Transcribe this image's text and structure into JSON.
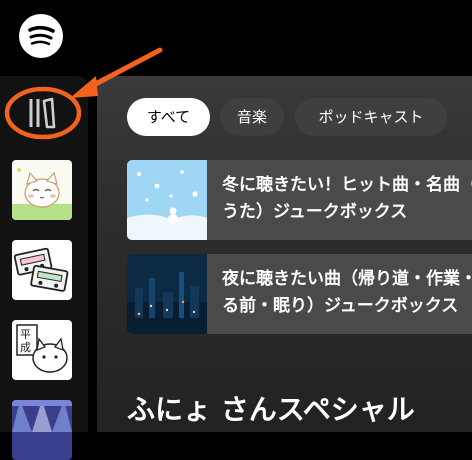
{
  "filters": [
    {
      "label": "すべて",
      "active": true
    },
    {
      "label": "音楽",
      "active": false
    },
    {
      "label": "ポッドキャスト",
      "active": false
    }
  ],
  "cards": [
    {
      "title": "冬に聴きたい！ヒット曲・名曲（冬うた）ジュークボックス"
    },
    {
      "title": "夜に聴きたい曲（帰り道・作業・寝る前・眠り）ジュークボックス"
    }
  ],
  "section": {
    "title": "ふにょ さんスペシャル"
  },
  "colors": {
    "annotation": "#f4631e",
    "sidebar": "#121212",
    "accent": "#ffffff"
  }
}
